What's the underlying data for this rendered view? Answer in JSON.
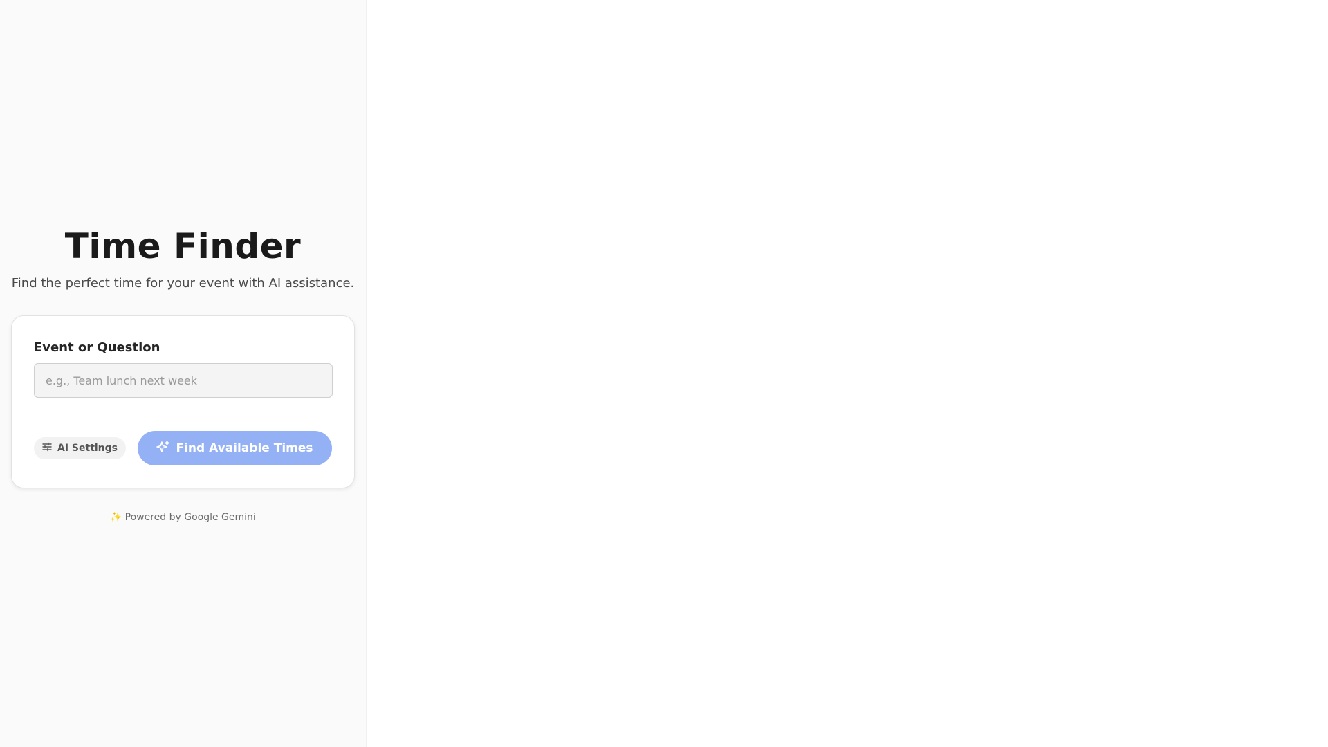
{
  "header": {
    "title": "Time Finder",
    "subtitle": "Find the perfect time for your event with AI assistance."
  },
  "form": {
    "label": "Event or Question",
    "input_value": "",
    "input_placeholder": "e.g., Team lunch next week"
  },
  "actions": {
    "settings_label": "AI Settings",
    "settings_icon": "sliders-icon",
    "find_label": "Find Available Times",
    "find_icon": "sparkles-icon",
    "find_color": "#94b1f5"
  },
  "footer": {
    "icon": "✨",
    "text": "Powered by Google Gemini"
  }
}
